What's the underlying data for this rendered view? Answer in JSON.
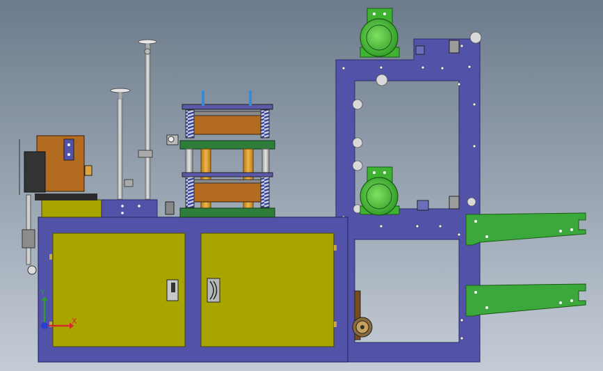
{
  "viewport": {
    "background_top": "#6c7b8c",
    "background_bottom": "#c4ccd6"
  },
  "axes_triad": {
    "x_label": "X",
    "y_label": "Y",
    "x_color": "#d42a2a",
    "y_color": "#2f9a36",
    "z_color": "#2d3fd0"
  },
  "colors": {
    "frame_purple": "#5252a8",
    "cabinet_olive": "#a8a400",
    "motor_green": "#4cc43c",
    "bracket_green": "#3aa83a",
    "spring_blue": "#3b4fb0",
    "column_orange": "#d49a2a",
    "heater_brown": "#b36b1f",
    "press_plate_green": "#2f7d3a"
  }
}
